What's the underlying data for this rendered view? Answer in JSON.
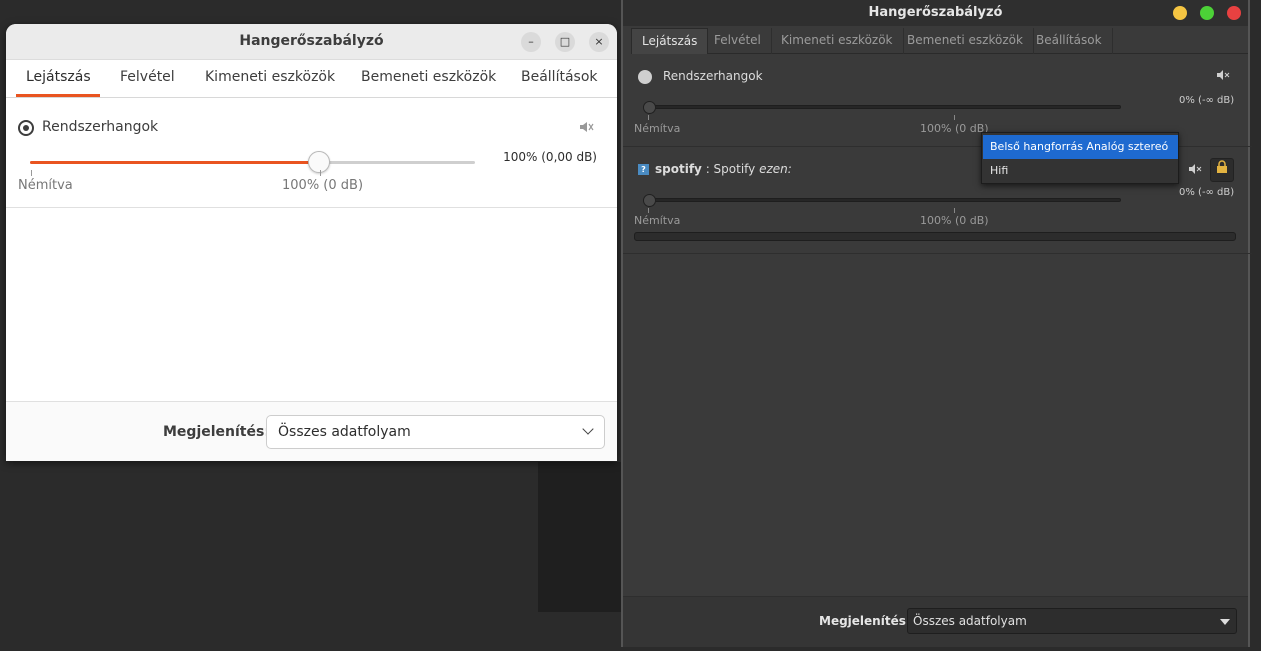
{
  "left_window": {
    "title": "Hangerőszabályzó",
    "controls": {
      "minimize": "–",
      "maximize": "□",
      "close": "×"
    },
    "tabs": [
      "Lejátszás",
      "Felvétel",
      "Kimeneti eszközök",
      "Bemeneti eszközök",
      "Beállítások"
    ],
    "active_tab": "Lejátszás",
    "stream": {
      "name": "Rendszerhangok",
      "volume_text": "100% (0,00 dB)",
      "volume_fraction": 0.65,
      "label_muted": "Némítva",
      "label_100": "100% (0 dB)"
    },
    "footer": {
      "label": "Megjelenítés:",
      "select_value": "Összes adatfolyam"
    },
    "accent": "#e95420"
  },
  "right_window": {
    "title": "Hangerőszabályzó",
    "tabs": [
      "Lejátszás",
      "Felvétel",
      "Kimeneti eszközök",
      "Bemeneti eszközök",
      "Beállítások"
    ],
    "active_tab": "Lejátszás",
    "streams": [
      {
        "name": "Rendszerhangok",
        "volume_text": "0% (-∞ dB)",
        "volume_fraction": 0.0,
        "label_muted": "Némítva",
        "label_100": "100% (0 dB)"
      },
      {
        "app": "spotify",
        "separator": " : ",
        "name": "Spotify",
        "suffix": "ezen:",
        "volume_text": "0% (-∞ dB)",
        "volume_fraction": 0.0,
        "label_muted": "Némítva",
        "label_100": "100% (0 dB)"
      }
    ],
    "popup": {
      "items": [
        "Belső hangforrás Analóg sztereó",
        "Hifi"
      ],
      "selected": "Belső hangforrás Analóg sztereó"
    },
    "footer": {
      "label": "Megjelenítés:",
      "select_value": "Összes adatfolyam"
    },
    "traffic_lights": {
      "minimize": "#f5c542",
      "maximize": "#4cd137",
      "close": "#e84141"
    }
  }
}
